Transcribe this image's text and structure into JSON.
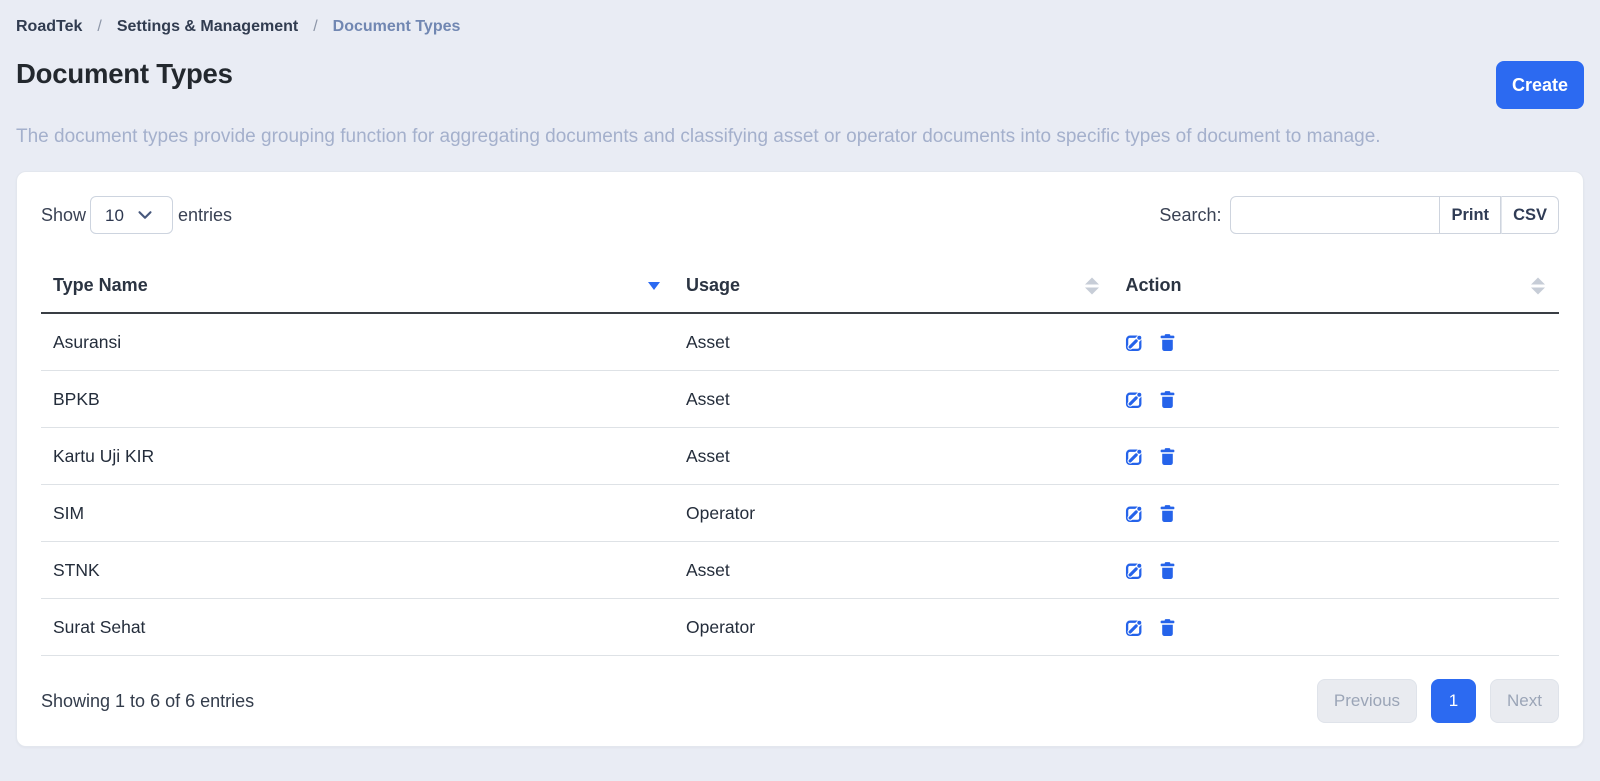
{
  "colors": {
    "accent": "#2c6af1",
    "page_background": "#e9ecf4",
    "card_background": "#ffffff",
    "muted_text": "#a5b1cb"
  },
  "breadcrumb": {
    "separator": "/",
    "items": [
      {
        "label": "RoadTek"
      },
      {
        "label": "Settings & Management"
      },
      {
        "label": "Document Types"
      }
    ]
  },
  "header": {
    "title": "Document Types",
    "create_label": "Create",
    "description": "The document types provide grouping function for aggregating documents and classifying asset or operator documents into specific types of document to manage."
  },
  "controls": {
    "show_label": "Show",
    "page_size_value": "10",
    "page_size_icon": "chevron-down-icon",
    "entries_label": "entries",
    "search_label": "Search:",
    "search_value": "",
    "print_label": "Print",
    "csv_label": "CSV"
  },
  "table": {
    "columns": [
      {
        "label": "Type Name",
        "sort_state": "sorted",
        "sort_icon": "triangle-down-icon"
      },
      {
        "label": "Usage",
        "sort_state": "unsorted",
        "sort_icon": "triangles-up-down-icon"
      },
      {
        "label": "Action",
        "sort_state": "unsorted",
        "sort_icon": "triangles-up-down-icon"
      }
    ],
    "row_action_icons": [
      "pencil-square-icon",
      "trash-icon"
    ],
    "rows": [
      {
        "type_name": "Asuransi",
        "usage": "Asset"
      },
      {
        "type_name": "BPKB",
        "usage": "Asset"
      },
      {
        "type_name": "Kartu Uji KIR",
        "usage": "Asset"
      },
      {
        "type_name": "SIM",
        "usage": "Operator"
      },
      {
        "type_name": "STNK",
        "usage": "Asset"
      },
      {
        "type_name": "Surat Sehat",
        "usage": "Operator"
      }
    ]
  },
  "footer": {
    "summary": "Showing 1 to 6 of 6 entries",
    "pagination": {
      "previous_label": "Previous",
      "active_page": "1",
      "next_label": "Next"
    }
  }
}
